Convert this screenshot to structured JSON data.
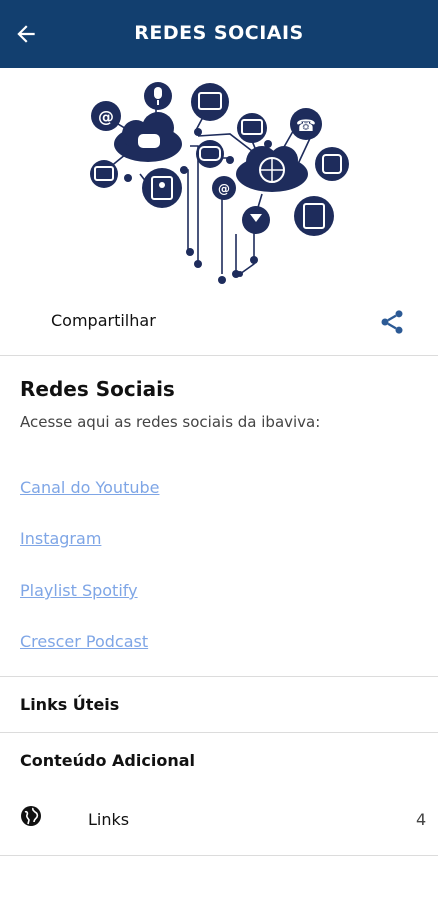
{
  "header": {
    "title": "REDES SOCIAIS",
    "back_icon": "arrow-left-icon",
    "background_color": "#123f6f"
  },
  "hero": {
    "image": "social-network-illustration",
    "color": "#1e2c5c"
  },
  "share": {
    "label": "Compartilhar",
    "icon": "share-icon",
    "icon_color": "#2c5a95"
  },
  "content": {
    "title": "Redes Sociais",
    "description": "Acesse aqui as redes sociais da ibaviva:",
    "links": [
      {
        "label": "Canal do Youtube"
      },
      {
        "label": "Instagram"
      },
      {
        "label": "Playlist Spotify"
      },
      {
        "label": "Crescer Podcast"
      }
    ],
    "link_color": "#7fa6e6"
  },
  "useful_links": {
    "title": "Links Úteis"
  },
  "additional": {
    "title": "Conteúdo Adicional",
    "items": [
      {
        "label": "Links",
        "count": "4",
        "icon": "globe-icon"
      }
    ]
  }
}
